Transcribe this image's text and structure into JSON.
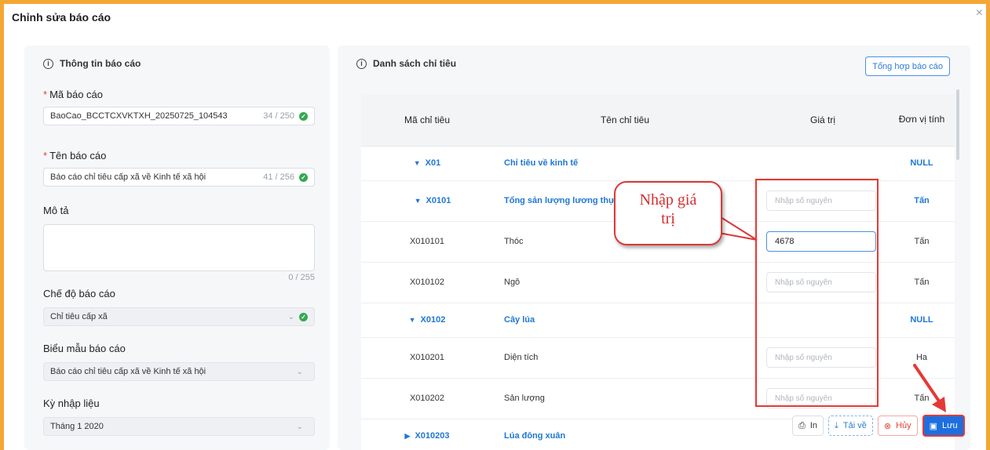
{
  "modal": {
    "title": "Chỉnh sửa báo cáo",
    "close_icon": "×"
  },
  "left_panel": {
    "header": "Thông tin báo cáo",
    "report_code": {
      "label": "Mã báo cáo",
      "value": "BaoCao_BCCTCXVKTXH_20250725_104543",
      "count": "34 / 250"
    },
    "report_name": {
      "label": "Tên báo cáo",
      "value": "Báo cáo chỉ tiêu cấp xã về Kinh tế xã hội",
      "count": "41 / 256"
    },
    "description": {
      "label": "Mô tả",
      "count": "0 / 255"
    },
    "report_mode": {
      "label": "Chế độ báo cáo",
      "value": "Chỉ tiêu cấp xã"
    },
    "report_template": {
      "label": "Biểu mẫu báo cáo",
      "value": "Báo cáo chỉ tiêu cấp xã về Kinh tế xã hội"
    },
    "input_period": {
      "label": "Kỳ nhập liệu",
      "value": "Tháng 1 2020"
    }
  },
  "right_panel": {
    "header": "Danh sách chỉ tiêu",
    "summary_button": "Tổng hợp báo cáo",
    "table": {
      "columns": [
        "Mã chỉ tiêu",
        "Tên chỉ tiêu",
        "Giá trị",
        "Đơn vị tính"
      ],
      "rows": [
        {
          "code": "X01",
          "name": "Chỉ tiêu về kinh tế",
          "value": "",
          "unit": "NULL"
        },
        {
          "code": "X0101",
          "name": "Tổng sản lượng lương thực",
          "value": "",
          "placeholder": "Nhập số nguyên",
          "unit": "Tấn"
        },
        {
          "code": "X010101",
          "name": "Thóc",
          "value": "4678",
          "placeholder": "Nhập số nguyên",
          "unit": "Tấn"
        },
        {
          "code": "X010102",
          "name": "Ngô",
          "value": "",
          "placeholder": "Nhập số nguyên",
          "unit": "Tấn"
        },
        {
          "code": "X0102",
          "name": "Cây lúa",
          "value": "",
          "unit": "NULL"
        },
        {
          "code": "X010201",
          "name": "Diện tích",
          "value": "",
          "placeholder": "Nhập số nguyên",
          "unit": "Ha"
        },
        {
          "code": "X010202",
          "name": "Sản lượng",
          "value": "",
          "placeholder": "Nhập số nguyên",
          "unit": "Tấn"
        },
        {
          "code": "X010203",
          "name": "Lúa đông xuân",
          "value": "",
          "unit": ""
        }
      ]
    }
  },
  "callout": {
    "line1": "Nhập giá",
    "line2": "trị"
  },
  "actions": {
    "print": "In",
    "download": "Tải về",
    "cancel": "Hủy",
    "save": "Lưu"
  },
  "colors": {
    "accent": "#1d6fe0",
    "highlight_red": "#e53935",
    "frame_orange": "#f5a733"
  }
}
